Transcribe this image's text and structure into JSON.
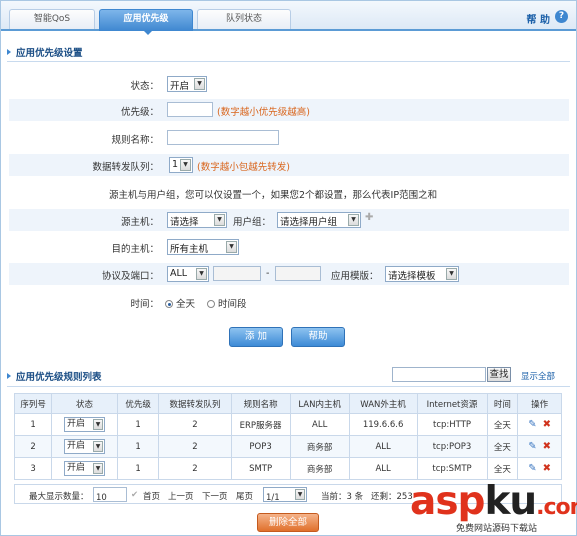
{
  "tabs": [
    {
      "label": "智能QoS"
    },
    {
      "label": "应用优先级"
    },
    {
      "label": "队列状态"
    }
  ],
  "help_label": "帮 助",
  "help_icon_glyph": "?",
  "settings": {
    "title": "应用优先级设置",
    "status_label": "状态：",
    "status_value": "开启",
    "priority_label": "优先级：",
    "priority_hint": "(数字越小优先级越高)",
    "rule_name_label": "规则名称：",
    "queue_label": "数据转发队列：",
    "queue_value": "1",
    "queue_hint": "(数字越小包越先转发)",
    "note": "源主机与用户组，您可以仅设置一个，如果您2个都设置，那么代表IP范围之和",
    "source_host_label": "源主机：",
    "source_host_value": "请选择",
    "user_group_label": "用户组：",
    "user_group_value": "请选择用户组",
    "dest_host_label": "目的主机：",
    "dest_host_value": "所有主机",
    "proto_label": "协议及端口：",
    "proto_value": "ALL",
    "port_sep": "-",
    "app_template_label": "应用模版：",
    "app_template_value": "请选择模板",
    "time_label": "时间：",
    "time_all": "全天",
    "time_range": "时间段",
    "add_button": "添 加",
    "help_button": "帮助"
  },
  "rules": {
    "title": "应用优先级规则列表",
    "search_button": "查找",
    "show_all": "显示全部",
    "columns": [
      "序列号",
      "状态",
      "优先级",
      "数据转发队列",
      "规则名称",
      "LAN内主机",
      "WAN外主机",
      "Internet资源",
      "时间",
      "操作"
    ],
    "rows": [
      {
        "seq": "1",
        "status": "开启",
        "priority": "1",
        "queue": "2",
        "name": "ERP服务器",
        "lan": "ALL",
        "wan": "119.6.6.6",
        "resource": "tcp:HTTP",
        "time": "全天"
      },
      {
        "seq": "2",
        "status": "开启",
        "priority": "1",
        "queue": "2",
        "name": "POP3",
        "lan": "商务部",
        "wan": "ALL",
        "resource": "tcp:POP3",
        "time": "全天"
      },
      {
        "seq": "3",
        "status": "开启",
        "priority": "1",
        "queue": "2",
        "name": "SMTP",
        "lan": "商务部",
        "wan": "ALL",
        "resource": "tcp:SMTP",
        "time": "全天"
      }
    ],
    "pager": {
      "max_label": "最大显示数量：",
      "max_value": "10",
      "first": "首页",
      "prev": "上一页",
      "next": "下一页",
      "last": "尾页",
      "page_value": "1/1",
      "current": "当前：3 条",
      "remaining": "还剩：253"
    },
    "delete_all_button": "删除全部"
  },
  "watermark": {
    "text_a": "asp",
    "text_b": "ku",
    "text_c": ".com",
    "sub": "免费网站源码下载站"
  }
}
